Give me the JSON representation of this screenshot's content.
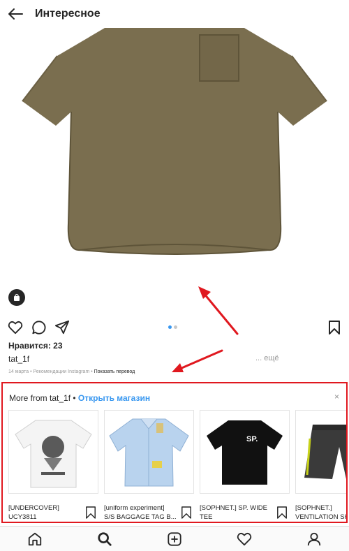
{
  "header": {
    "title": "Интересное"
  },
  "post": {
    "likes": "Нравится: 23",
    "username": "tat_1f",
    "more": "... ещё",
    "date_source": "14 марта • Рекомендации Instagram • ",
    "translate": "Показать перевод",
    "carousel_pages": 2,
    "carousel_active": 1
  },
  "shop": {
    "title": "More from tat_1f",
    "separator": " • ",
    "open_shop": "Открыть магазин",
    "close": "×",
    "products": [
      {
        "line1": "[UNDERCOVER]",
        "line2": "UCY3811"
      },
      {
        "line1": "[uniform experiment]",
        "line2": "S/S BAGGAGE TAG B..."
      },
      {
        "line1": "[SOPHNET.] SP. WIDE",
        "line2": "TEE"
      },
      {
        "line1": "[SOPHNET.]",
        "line2": "VENTILATION SH"
      }
    ]
  },
  "colors": {
    "accent": "#3897f0",
    "highlight": "#e0181f",
    "shirt": "#7a6e4f"
  }
}
